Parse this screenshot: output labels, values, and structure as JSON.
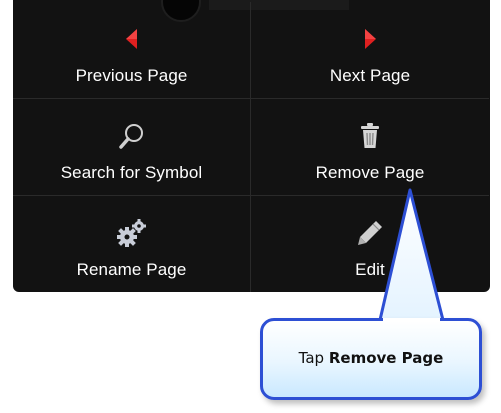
{
  "menu": {
    "items": [
      {
        "label": "Previous Page",
        "icon": "left-arrow-icon"
      },
      {
        "label": "Next Page",
        "icon": "right-arrow-icon"
      },
      {
        "label": "Search for Symbol",
        "icon": "search-icon"
      },
      {
        "label": "Remove Page",
        "icon": "trash-icon"
      },
      {
        "label": "Rename Page",
        "icon": "gears-icon"
      },
      {
        "label": "Edit",
        "icon": "pencil-icon"
      }
    ]
  },
  "callout": {
    "prefix": "Tap ",
    "emphasis": "Remove Page"
  },
  "colors": {
    "menu_background": "#121212",
    "arrow_red": "#e02020",
    "icon_gray": "#cfcfcf",
    "callout_border": "#2d4fd4"
  }
}
